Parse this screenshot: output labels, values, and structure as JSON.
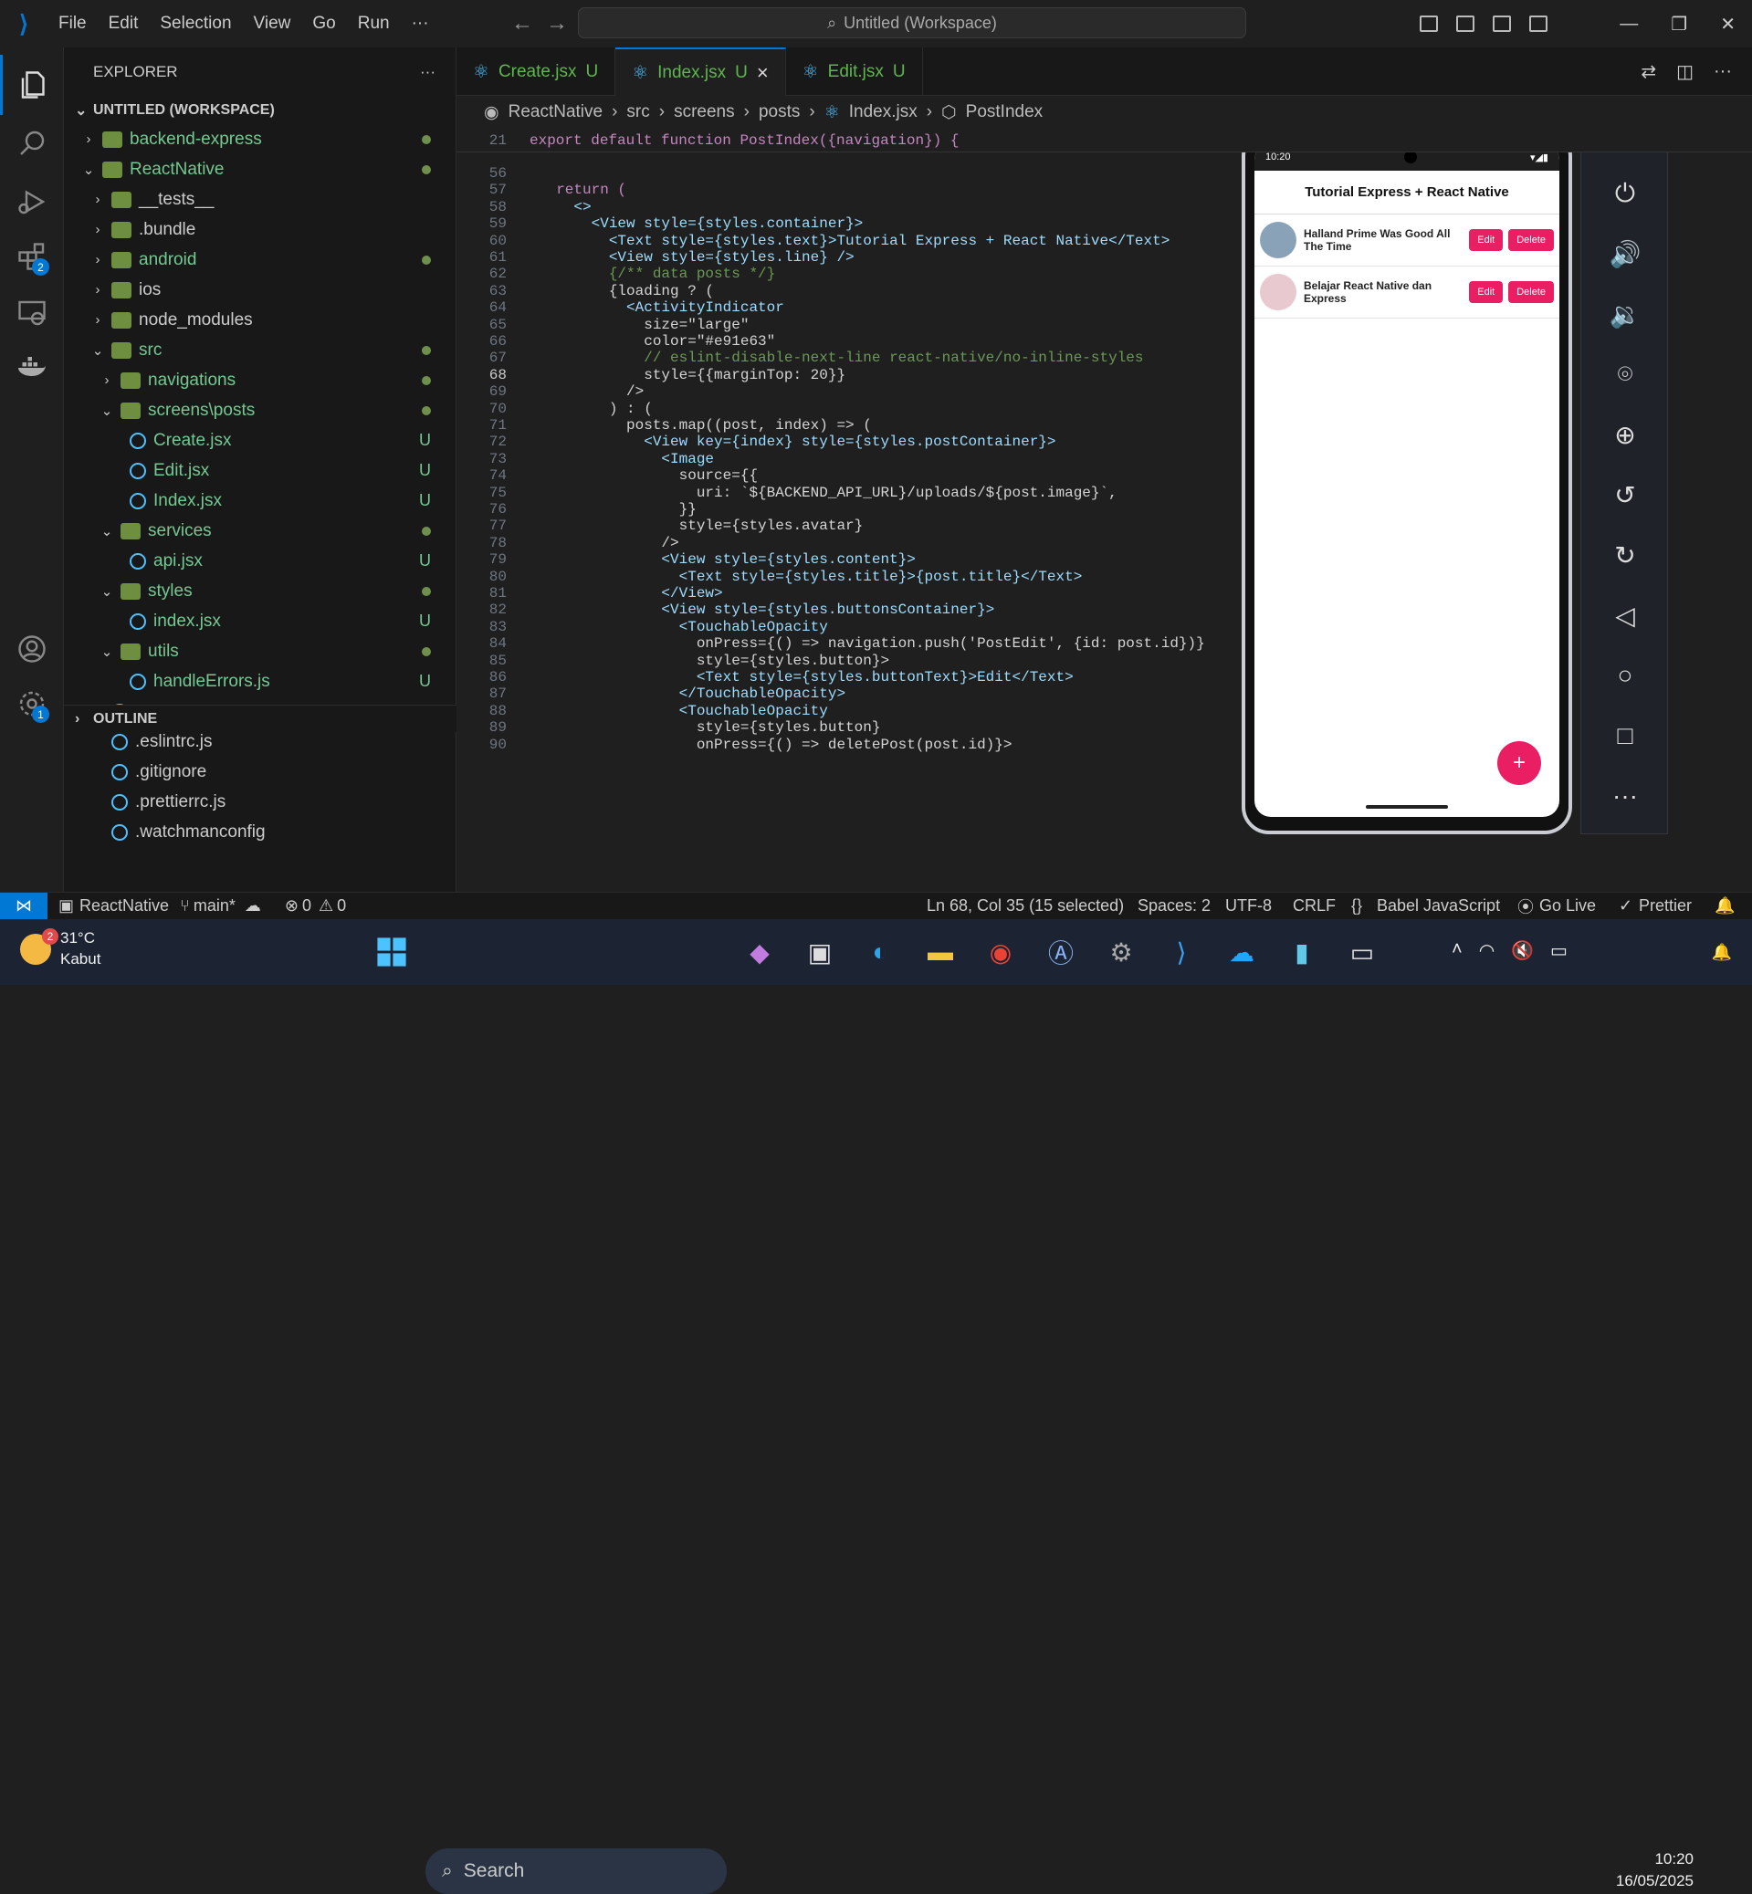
{
  "titlebar": {
    "menu": [
      "File",
      "Edit",
      "Selection",
      "View",
      "Go",
      "Run",
      "···"
    ],
    "search": "Untitled (Workspace)"
  },
  "activity": {
    "extensions_badge": "2",
    "settings_badge": "1"
  },
  "explorer": {
    "title": "EXPLORER",
    "workspace": "UNTITLED (WORKSPACE)",
    "outline": "OUTLINE",
    "rows": [
      {
        "label": "backend-express",
        "indent": 0,
        "chev": "›",
        "status": "dot"
      },
      {
        "label": "ReactNative",
        "indent": 0,
        "chev": "⌄",
        "status": "dot"
      },
      {
        "label": "__tests__",
        "indent": 1,
        "chev": "›",
        "status": ""
      },
      {
        "label": ".bundle",
        "indent": 1,
        "chev": "›",
        "status": ""
      },
      {
        "label": "android",
        "indent": 1,
        "chev": "›",
        "status": "dot"
      },
      {
        "label": "ios",
        "indent": 1,
        "chev": "›",
        "status": ""
      },
      {
        "label": "node_modules",
        "indent": 1,
        "chev": "›",
        "status": ""
      },
      {
        "label": "src",
        "indent": 1,
        "chev": "⌄",
        "status": "dot"
      },
      {
        "label": "navigations",
        "indent": 2,
        "chev": "›",
        "status": "dot"
      },
      {
        "label": "screens\\posts",
        "indent": 2,
        "chev": "⌄",
        "status": "dot"
      },
      {
        "label": "Create.jsx",
        "indent": 3,
        "chev": "",
        "status": "U"
      },
      {
        "label": "Edit.jsx",
        "indent": 3,
        "chev": "",
        "status": "U"
      },
      {
        "label": "Index.jsx",
        "indent": 3,
        "chev": "",
        "status": "U"
      },
      {
        "label": "services",
        "indent": 2,
        "chev": "⌄",
        "status": "dot"
      },
      {
        "label": "api.jsx",
        "indent": 3,
        "chev": "",
        "status": "U"
      },
      {
        "label": "styles",
        "indent": 2,
        "chev": "⌄",
        "status": "dot"
      },
      {
        "label": "index.jsx",
        "indent": 3,
        "chev": "",
        "status": "U"
      },
      {
        "label": "utils",
        "indent": 2,
        "chev": "⌄",
        "status": "dot"
      },
      {
        "label": "handleErrors.js",
        "indent": 3,
        "chev": "",
        "status": "U"
      },
      {
        "label": ".env",
        "indent": 1,
        "chev": "",
        "status": "U"
      },
      {
        "label": ".eslintrc.js",
        "indent": 1,
        "chev": "",
        "status": ""
      },
      {
        "label": ".gitignore",
        "indent": 1,
        "chev": "",
        "status": ""
      },
      {
        "label": ".prettierrc.js",
        "indent": 1,
        "chev": "",
        "status": ""
      },
      {
        "label": ".watchmanconfig",
        "indent": 1,
        "chev": "",
        "status": ""
      }
    ]
  },
  "tabs": [
    {
      "label": "Create.jsx",
      "status": "U"
    },
    {
      "label": "Index.jsx",
      "status": "U",
      "active": true
    },
    {
      "label": "Edit.jsx",
      "status": "U"
    }
  ],
  "breadcrumb": [
    "ReactNative",
    "src",
    "screens",
    "posts",
    "Index.jsx",
    "PostIndex"
  ],
  "sticky_line": {
    "num": "21",
    "text": "export default function PostIndex({navigation}) {"
  },
  "code": [
    {
      "n": "56",
      "t": ""
    },
    {
      "n": "57",
      "t": "  return ("
    },
    {
      "n": "58",
      "t": "    <>"
    },
    {
      "n": "59",
      "t": "      <View style={styles.container}>"
    },
    {
      "n": "60",
      "t": "        <Text style={styles.text}>Tutorial Express + React Native</Text>"
    },
    {
      "n": "61",
      "t": "        <View style={styles.line} />"
    },
    {
      "n": "62",
      "t": "        {/** data posts */}"
    },
    {
      "n": "63",
      "t": "        {loading ? ("
    },
    {
      "n": "64",
      "t": "          <ActivityIndicator"
    },
    {
      "n": "65",
      "t": "            size=\"large\""
    },
    {
      "n": "66",
      "t": "            color=\"#e91e63\""
    },
    {
      "n": "67",
      "t": "            // eslint-disable-next-line react-native/no-inline-styles"
    },
    {
      "n": "68",
      "t": "            style={{marginTop: 20}}"
    },
    {
      "n": "69",
      "t": "          />"
    },
    {
      "n": "70",
      "t": "        ) : ("
    },
    {
      "n": "71",
      "t": "          posts.map((post, index) => ("
    },
    {
      "n": "72",
      "t": "            <View key={index} style={styles.postContainer}>"
    },
    {
      "n": "73",
      "t": "              <Image"
    },
    {
      "n": "74",
      "t": "                source={{"
    },
    {
      "n": "75",
      "t": "                  uri: `${BACKEND_API_URL}/uploads/${post.image}`,"
    },
    {
      "n": "76",
      "t": "                }}"
    },
    {
      "n": "77",
      "t": "                style={styles.avatar}"
    },
    {
      "n": "78",
      "t": "              />"
    },
    {
      "n": "79",
      "t": "              <View style={styles.content}>"
    },
    {
      "n": "80",
      "t": "                <Text style={styles.title}>{post.title}</Text>"
    },
    {
      "n": "81",
      "t": "              </View>"
    },
    {
      "n": "82",
      "t": "              <View style={styles.buttonsContainer}>"
    },
    {
      "n": "83",
      "t": "                <TouchableOpacity"
    },
    {
      "n": "84",
      "t": "                  onPress={() => navigation.push('PostEdit', {id: post.id})}"
    },
    {
      "n": "85",
      "t": "                  style={styles.button}>"
    },
    {
      "n": "86",
      "t": "                  <Text style={styles.buttonText}>Edit</Text>"
    },
    {
      "n": "87",
      "t": "                </TouchableOpacity>"
    },
    {
      "n": "88",
      "t": "                <TouchableOpacity"
    },
    {
      "n": "89",
      "t": "                  style={styles.button}"
    },
    {
      "n": "90",
      "t": "                  onPress={() => deletePost(post.id)}>"
    }
  ],
  "phone": {
    "time": "10:20",
    "header": "Tutorial Express + React Native",
    "posts": [
      {
        "title": "Halland Prime Was Good All The Time",
        "edit": "Edit",
        "delete": "Delete"
      },
      {
        "title": "Belajar React Native dan Express",
        "edit": "Edit",
        "delete": "Delete"
      }
    ],
    "fab": "+"
  },
  "statusbar": {
    "project": "ReactNative",
    "branch": "main*",
    "errors": "0",
    "warnings": "0",
    "position": "Ln 68, Col 35 (15 selected)",
    "spaces": "Spaces: 2",
    "encoding": "UTF-8",
    "eol": "CRLF",
    "language": "Babel JavaScript",
    "golive": "Go Live",
    "prettier": "Prettier"
  },
  "taskbar": {
    "weather_temp": "31°C",
    "weather_desc": "Kabut",
    "weather_badge": "2",
    "search": "Search",
    "time": "10:20",
    "date": "16/05/2025"
  },
  "colors": {
    "accent": "#0078d4",
    "untracked": "#5fb54f",
    "pink": "#e91e63"
  }
}
